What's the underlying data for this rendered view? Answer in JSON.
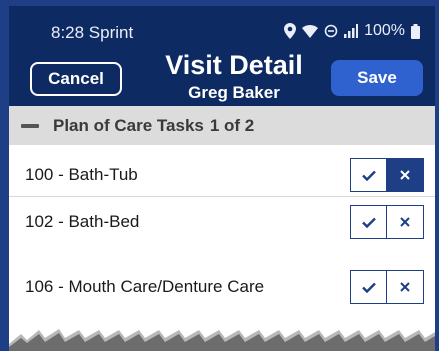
{
  "status": {
    "time": "8:28 Sprint",
    "battery": "100%"
  },
  "header": {
    "cancel_label": "Cancel",
    "title": "Visit Detail",
    "subtitle": "Greg Baker",
    "save_label": "Save"
  },
  "section": {
    "title": "Plan of Care Tasks",
    "count": "1 of 2"
  },
  "tasks": [
    {
      "label": "100 - Bath-Tub",
      "state": "declined"
    },
    {
      "label": "102 - Bath-Bed",
      "state": "none"
    },
    {
      "label": "106 - Mouth Care/Denture Care",
      "state": "none"
    }
  ],
  "icons": {
    "collapse": "minus-icon",
    "complete": "check-icon",
    "decline": "x-icon",
    "location": "location-icon",
    "wifi": "wifi-icon",
    "signal": "signal-icon",
    "battery": "battery-icon"
  },
  "colors": {
    "header": "#0d2a63",
    "accent": "#2f62cf",
    "toggle": "#1e3f86",
    "section_bg": "#dcdcdc"
  }
}
